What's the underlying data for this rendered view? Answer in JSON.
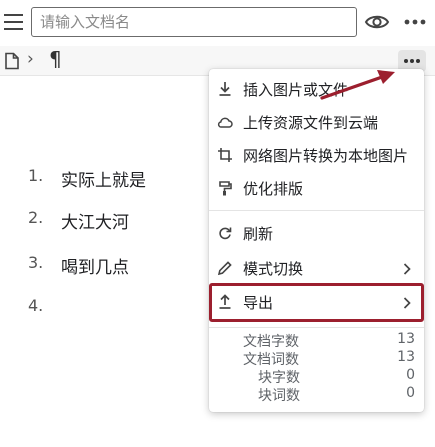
{
  "topbar": {
    "title_placeholder": "请输入文档名",
    "menu_icon": "hamburger-menu-icon",
    "preview_icon": "eye-icon",
    "more_icon": "more-horizontal-icon"
  },
  "breadcrumb": {
    "doc_icon": "document-icon",
    "separator": "›",
    "block_symbol": "¶",
    "block_more_icon": "more-horizontal-icon"
  },
  "document": {
    "items": [
      {
        "num": "1.",
        "text": "实际上就是"
      },
      {
        "num": "2.",
        "text": "大江大河"
      },
      {
        "num": "3.",
        "text": "喝到几点"
      },
      {
        "num": "4.",
        "text": ""
      }
    ]
  },
  "menu": {
    "items": [
      {
        "label": "插入图片或文件",
        "icon": "download-icon"
      },
      {
        "label": "上传资源文件到云端",
        "icon": "cloud-icon"
      },
      {
        "label": "网络图片转换为本地图片",
        "icon": "crop-icon"
      },
      {
        "label": "优化排版",
        "icon": "format-paint-icon"
      },
      {
        "label": "刷新",
        "icon": "refresh-icon"
      },
      {
        "label": "模式切换",
        "icon": "pencil-icon"
      },
      {
        "label": "导出",
        "icon": "upload-icon"
      }
    ],
    "highlighted_item": "导出",
    "highlight_color": "#9c1f2e"
  },
  "stats": [
    {
      "label": "文档字数",
      "value": "13"
    },
    {
      "label": "文档词数",
      "value": "13"
    },
    {
      "label": "块字数",
      "value": "0"
    },
    {
      "label": "块词数",
      "value": "0"
    }
  ],
  "colors": {
    "accent_red": "#9c1f2e",
    "text": "#202124",
    "muted": "#5f6368"
  }
}
